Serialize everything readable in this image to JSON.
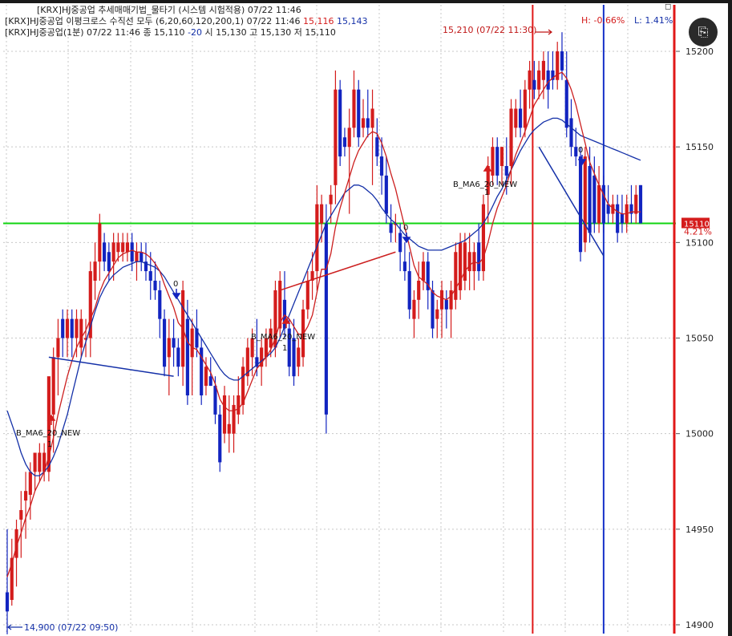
{
  "legend": {
    "line1": "[KRX]HJ중공업 추세매매기법_물타기 (시스템 시험적용) 07/22 11:46",
    "line2_prefix": "[KRX]HJ중공업 이평크로스 수직선 모두  (6,20,60,120,200,1) 07/22 11:46",
    "line2_val1": "15,116",
    "line2_val2": "15,143",
    "line3_prefix": "[KRX]HJ중공업(1분) 07/22 11:46   종 15,110",
    "line3_change": "-20",
    "line3_suffix": "  시 15,130 고 15,130 저 15,110"
  },
  "header_right": {
    "high_label": "H: -0.66%",
    "low_label": "L: 1.41%",
    "corner_glyph": "◻"
  },
  "ocr_button": {
    "label": "⎘"
  },
  "colors": {
    "up": "#d41c1c",
    "down": "#1224c0",
    "ma_short": "#cc1f1f",
    "ma_long": "#1430a8",
    "ref_line": "#11d411",
    "grid": "#c7c7c7",
    "axis_text": "#222222"
  },
  "chart_data": {
    "type": "candlestick",
    "y_axis": {
      "ticks": [
        15200,
        15150,
        15100,
        15050,
        15000,
        14950,
        14900
      ],
      "tick_labels": [
        "15200",
        "15150",
        "15100",
        "15050",
        "15000",
        "14950",
        "14900"
      ],
      "range": [
        14895,
        15215
      ],
      "current_price_label": "15110",
      "current_change_label": "4.21%"
    },
    "grid": true,
    "reference_line": 15110,
    "candles": [
      {
        "o": 14917,
        "h": 14950,
        "l": 14895,
        "c": 14907
      },
      {
        "o": 14913,
        "h": 14945,
        "l": 14910,
        "c": 14935
      },
      {
        "o": 14935,
        "h": 14955,
        "l": 14920,
        "c": 14950
      },
      {
        "o": 14955,
        "h": 14970,
        "l": 14935,
        "c": 14960
      },
      {
        "o": 14965,
        "h": 14980,
        "l": 14945,
        "c": 14970
      },
      {
        "o": 14968,
        "h": 14985,
        "l": 14955,
        "c": 14980
      },
      {
        "o": 14980,
        "h": 14985,
        "l": 14970,
        "c": 14990
      },
      {
        "o": 14980,
        "h": 14995,
        "l": 14975,
        "c": 14990
      },
      {
        "o": 14980,
        "h": 14995,
        "l": 14975,
        "c": 14990
      },
      {
        "o": 14980,
        "h": 15010,
        "l": 14975,
        "c": 15030
      },
      {
        "o": 15010,
        "h": 15045,
        "l": 14990,
        "c": 15040
      },
      {
        "o": 15040,
        "h": 15060,
        "l": 15020,
        "c": 15050
      },
      {
        "o": 15060,
        "h": 15065,
        "l": 15040,
        "c": 15050
      },
      {
        "o": 15050,
        "h": 15065,
        "l": 15040,
        "c": 15060
      },
      {
        "o": 15060,
        "h": 15065,
        "l": 15040,
        "c": 15050
      },
      {
        "o": 15050,
        "h": 15065,
        "l": 15040,
        "c": 15060
      },
      {
        "o": 15045,
        "h": 15065,
        "l": 15040,
        "c": 15060
      },
      {
        "o": 15050,
        "h": 15060,
        "l": 15040,
        "c": 15050
      },
      {
        "o": 15050,
        "h": 15090,
        "l": 15040,
        "c": 15085
      },
      {
        "o": 15080,
        "h": 15100,
        "l": 15070,
        "c": 15090
      },
      {
        "o": 15090,
        "h": 15115,
        "l": 15080,
        "c": 15110
      },
      {
        "o": 15100,
        "h": 15105,
        "l": 15085,
        "c": 15090
      },
      {
        "o": 15095,
        "h": 15100,
        "l": 15080,
        "c": 15085
      },
      {
        "o": 15090,
        "h": 15105,
        "l": 15080,
        "c": 15100
      },
      {
        "o": 15095,
        "h": 15105,
        "l": 15090,
        "c": 15100
      },
      {
        "o": 15095,
        "h": 15105,
        "l": 15090,
        "c": 15100
      },
      {
        "o": 15095,
        "h": 15105,
        "l": 15090,
        "c": 15100
      },
      {
        "o": 15100,
        "h": 15105,
        "l": 15085,
        "c": 15090
      },
      {
        "o": 15090,
        "h": 15100,
        "l": 15080,
        "c": 15095
      },
      {
        "o": 15095,
        "h": 15100,
        "l": 15085,
        "c": 15090
      },
      {
        "o": 15090,
        "h": 15100,
        "l": 15080,
        "c": 15085
      },
      {
        "o": 15085,
        "h": 15095,
        "l": 15070,
        "c": 15080
      },
      {
        "o": 15080,
        "h": 15090,
        "l": 15070,
        "c": 15075
      },
      {
        "o": 15075,
        "h": 15080,
        "l": 15050,
        "c": 15060
      },
      {
        "o": 15060,
        "h": 15065,
        "l": 15030,
        "c": 15035
      },
      {
        "o": 15040,
        "h": 15060,
        "l": 15020,
        "c": 15050
      },
      {
        "o": 15050,
        "h": 15060,
        "l": 15035,
        "c": 15045
      },
      {
        "o": 15045,
        "h": 15050,
        "l": 15030,
        "c": 15035
      },
      {
        "o": 15035,
        "h": 15080,
        "l": 15025,
        "c": 15075
      },
      {
        "o": 15060,
        "h": 15070,
        "l": 15015,
        "c": 15020
      },
      {
        "o": 15040,
        "h": 15060,
        "l": 15020,
        "c": 15055
      },
      {
        "o": 15055,
        "h": 15065,
        "l": 15040,
        "c": 15045
      },
      {
        "o": 15045,
        "h": 15050,
        "l": 15015,
        "c": 15020
      },
      {
        "o": 15025,
        "h": 15040,
        "l": 15020,
        "c": 15035
      },
      {
        "o": 15030,
        "h": 15040,
        "l": 15025,
        "c": 15025
      },
      {
        "o": 15025,
        "h": 15030,
        "l": 15005,
        "c": 15010
      },
      {
        "o": 15010,
        "h": 15015,
        "l": 14980,
        "c": 14985
      },
      {
        "o": 15000,
        "h": 15025,
        "l": 14995,
        "c": 15020
      },
      {
        "o": 15000,
        "h": 15020,
        "l": 14990,
        "c": 15005
      },
      {
        "o": 15000,
        "h": 15020,
        "l": 14990,
        "c": 15015
      },
      {
        "o": 15010,
        "h": 15030,
        "l": 15005,
        "c": 15020
      },
      {
        "o": 15015,
        "h": 15040,
        "l": 15010,
        "c": 15035
      },
      {
        "o": 15030,
        "h": 15050,
        "l": 15025,
        "c": 15045
      },
      {
        "o": 15040,
        "h": 15055,
        "l": 15030,
        "c": 15050
      },
      {
        "o": 15040,
        "h": 15060,
        "l": 15030,
        "c": 15035
      },
      {
        "o": 15035,
        "h": 15050,
        "l": 15025,
        "c": 15045
      },
      {
        "o": 15040,
        "h": 15055,
        "l": 15035,
        "c": 15050
      },
      {
        "o": 15045,
        "h": 15060,
        "l": 15040,
        "c": 15055
      },
      {
        "o": 15045,
        "h": 15080,
        "l": 15040,
        "c": 15075
      },
      {
        "o": 15055,
        "h": 15085,
        "l": 15050,
        "c": 15080
      },
      {
        "o": 15070,
        "h": 15085,
        "l": 15050,
        "c": 15055
      },
      {
        "o": 15055,
        "h": 15060,
        "l": 15030,
        "c": 15035
      },
      {
        "o": 15050,
        "h": 15060,
        "l": 15025,
        "c": 15030
      },
      {
        "o": 15035,
        "h": 15050,
        "l": 15030,
        "c": 15045
      },
      {
        "o": 15040,
        "h": 15070,
        "l": 15035,
        "c": 15065
      },
      {
        "o": 15065,
        "h": 15085,
        "l": 15060,
        "c": 15080
      },
      {
        "o": 15080,
        "h": 15095,
        "l": 15070,
        "c": 15085
      },
      {
        "o": 15085,
        "h": 15130,
        "l": 15075,
        "c": 15120
      },
      {
        "o": 15110,
        "h": 15125,
        "l": 15100,
        "c": 15120
      },
      {
        "o": 15110,
        "h": 15120,
        "l": 15000,
        "c": 15010
      },
      {
        "o": 15120,
        "h": 15130,
        "l": 15110,
        "c": 15125
      },
      {
        "o": 15130,
        "h": 15190,
        "l": 15120,
        "c": 15180
      },
      {
        "o": 15180,
        "h": 15185,
        "l": 15140,
        "c": 15145
      },
      {
        "o": 15155,
        "h": 15160,
        "l": 15145,
        "c": 15150
      },
      {
        "o": 15150,
        "h": 15170,
        "l": 15115,
        "c": 15160
      },
      {
        "o": 15160,
        "h": 15190,
        "l": 15155,
        "c": 15180
      },
      {
        "o": 15180,
        "h": 15185,
        "l": 15150,
        "c": 15155
      },
      {
        "o": 15160,
        "h": 15175,
        "l": 15155,
        "c": 15165
      },
      {
        "o": 15165,
        "h": 15180,
        "l": 15155,
        "c": 15160
      },
      {
        "o": 15160,
        "h": 15180,
        "l": 15130,
        "c": 15170
      },
      {
        "o": 15155,
        "h": 15165,
        "l": 15140,
        "c": 15145
      },
      {
        "o": 15145,
        "h": 15155,
        "l": 15125,
        "c": 15135
      },
      {
        "o": 15135,
        "h": 15145,
        "l": 15110,
        "c": 15115
      },
      {
        "o": 15110,
        "h": 15120,
        "l": 15100,
        "c": 15105
      },
      {
        "o": 15110,
        "h": 15115,
        "l": 15100,
        "c": 15110
      },
      {
        "o": 15105,
        "h": 15110,
        "l": 15085,
        "c": 15095
      },
      {
        "o": 15090,
        "h": 15100,
        "l": 15080,
        "c": 15085
      },
      {
        "o": 15085,
        "h": 15095,
        "l": 15060,
        "c": 15065
      },
      {
        "o": 15060,
        "h": 15075,
        "l": 15050,
        "c": 15070
      },
      {
        "o": 15070,
        "h": 15090,
        "l": 15060,
        "c": 15080
      },
      {
        "o": 15080,
        "h": 15095,
        "l": 15075,
        "c": 15090
      },
      {
        "o": 15090,
        "h": 15095,
        "l": 15065,
        "c": 15075
      },
      {
        "o": 15075,
        "h": 15080,
        "l": 15050,
        "c": 15055
      },
      {
        "o": 15060,
        "h": 15070,
        "l": 15050,
        "c": 15065
      },
      {
        "o": 15065,
        "h": 15080,
        "l": 15050,
        "c": 15075
      },
      {
        "o": 15070,
        "h": 15075,
        "l": 15055,
        "c": 15065
      },
      {
        "o": 15065,
        "h": 15080,
        "l": 15050,
        "c": 15075
      },
      {
        "o": 15070,
        "h": 15100,
        "l": 15065,
        "c": 15095
      },
      {
        "o": 15075,
        "h": 15105,
        "l": 15070,
        "c": 15100
      },
      {
        "o": 15080,
        "h": 15105,
        "l": 15075,
        "c": 15100
      },
      {
        "o": 15085,
        "h": 15105,
        "l": 15075,
        "c": 15095
      },
      {
        "o": 15085,
        "h": 15100,
        "l": 15075,
        "c": 15095
      },
      {
        "o": 15100,
        "h": 15110,
        "l": 15080,
        "c": 15085
      },
      {
        "o": 15085,
        "h": 15125,
        "l": 15080,
        "c": 15120
      },
      {
        "o": 15125,
        "h": 15145,
        "l": 15110,
        "c": 15140
      },
      {
        "o": 15135,
        "h": 15155,
        "l": 15130,
        "c": 15150
      },
      {
        "o": 15150,
        "h": 15155,
        "l": 15130,
        "c": 15135
      },
      {
        "o": 15140,
        "h": 15150,
        "l": 15130,
        "c": 15150
      },
      {
        "o": 15140,
        "h": 15155,
        "l": 15125,
        "c": 15135
      },
      {
        "o": 15140,
        "h": 15175,
        "l": 15130,
        "c": 15170
      },
      {
        "o": 15160,
        "h": 15175,
        "l": 15155,
        "c": 15170
      },
      {
        "o": 15170,
        "h": 15180,
        "l": 15155,
        "c": 15160
      },
      {
        "o": 15160,
        "h": 15185,
        "l": 15155,
        "c": 15180
      },
      {
        "o": 15180,
        "h": 15195,
        "l": 15170,
        "c": 15190
      },
      {
        "o": 15185,
        "h": 15195,
        "l": 15175,
        "c": 15180
      },
      {
        "o": 15180,
        "h": 15195,
        "l": 15175,
        "c": 15190
      },
      {
        "o": 15185,
        "h": 15200,
        "l": 15175,
        "c": 15195
      },
      {
        "o": 15190,
        "h": 15200,
        "l": 15170,
        "c": 15180
      },
      {
        "o": 15190,
        "h": 15200,
        "l": 15180,
        "c": 15185
      },
      {
        "o": 15185,
        "h": 15205,
        "l": 15180,
        "c": 15200
      },
      {
        "o": 15200,
        "h": 15210,
        "l": 15185,
        "c": 15190
      },
      {
        "o": 15185,
        "h": 15200,
        "l": 15155,
        "c": 15160
      },
      {
        "o": 15165,
        "h": 15175,
        "l": 15145,
        "c": 15150
      },
      {
        "o": 15150,
        "h": 15160,
        "l": 15140,
        "c": 15145
      },
      {
        "o": 15145,
        "h": 15150,
        "l": 15090,
        "c": 15095
      },
      {
        "o": 15100,
        "h": 15150,
        "l": 15095,
        "c": 15145
      },
      {
        "o": 15140,
        "h": 15150,
        "l": 15100,
        "c": 15105
      },
      {
        "o": 15135,
        "h": 15145,
        "l": 15105,
        "c": 15110
      },
      {
        "o": 15110,
        "h": 15140,
        "l": 15105,
        "c": 15130
      },
      {
        "o": 15130,
        "h": 15135,
        "l": 15105,
        "c": 15110
      },
      {
        "o": 15120,
        "h": 15130,
        "l": 15110,
        "c": 15115
      },
      {
        "o": 15115,
        "h": 15125,
        "l": 15110,
        "c": 15120
      },
      {
        "o": 15120,
        "h": 15125,
        "l": 15100,
        "c": 15105
      },
      {
        "o": 15115,
        "h": 15125,
        "l": 15105,
        "c": 15110
      },
      {
        "o": 15110,
        "h": 15125,
        "l": 15105,
        "c": 15120
      },
      {
        "o": 15120,
        "h": 15130,
        "l": 15110,
        "c": 15115
      },
      {
        "o": 15115,
        "h": 15130,
        "l": 15110,
        "c": 15125
      },
      {
        "o": 15130,
        "h": 15130,
        "l": 15110,
        "c": 15110
      }
    ],
    "ma_short": [
      14925,
      14932,
      14941,
      14948,
      14956,
      14962,
      14970,
      14975,
      14980,
      14988,
      14998,
      15010,
      15020,
      15030,
      15038,
      15045,
      15050,
      15054,
      15060,
      15066,
      15074,
      15080,
      15084,
      15088,
      15092,
      15094,
      15095,
      15096,
      15095,
      15095,
      15094,
      15092,
      15089,
      15085,
      15078,
      15072,
      15066,
      15058,
      15055,
      15048,
      15045,
      15044,
      15040,
      15036,
      15032,
      15026,
      15018,
      15014,
      15012,
      15012,
      15013,
      15016,
      15022,
      15028,
      15034,
      15037,
      15040,
      15044,
      15050,
      15058,
      15062,
      15060,
      15056,
      15052,
      15052,
      15056,
      15062,
      15074,
      15086,
      15086,
      15094,
      15108,
      15118,
      15126,
      15134,
      15142,
      15148,
      15152,
      15156,
      15158,
      15157,
      15152,
      15145,
      15136,
      15128,
      15118,
      15108,
      15098,
      15088,
      15082,
      15080,
      15078,
      15074,
      15072,
      15071,
      15070,
      15072,
      15076,
      15080,
      15085,
      15088,
      15090,
      15089,
      15092,
      15100,
      15110,
      15118,
      15124,
      15130,
      15138,
      15146,
      15152,
      15158,
      15165,
      15172,
      15176,
      15180,
      15184,
      15186,
      15188,
      15189,
      15186,
      15180,
      15172,
      15162,
      15152,
      15142,
      15136,
      15130,
      15125,
      15120,
      15118,
      15116,
      15115,
      15115,
      15116,
      15116,
      15116
    ],
    "ma_long": [
      15012,
      15005,
      14998,
      14990,
      14984,
      14980,
      14978,
      14978,
      14980,
      14983,
      14988,
      14994,
      15002,
      15010,
      15020,
      15030,
      15040,
      15048,
      15056,
      15064,
      15071,
      15076,
      15080,
      15083,
      15085,
      15087,
      15088,
      15089,
      15090,
      15090,
      15089,
      15088,
      15087,
      15085,
      15082,
      15078,
      15074,
      15070,
      15066,
      15062,
      15058,
      15054,
      15050,
      15046,
      15042,
      15038,
      15034,
      15031,
      15029,
      15028,
      15028,
      15030,
      15032,
      15034,
      15036,
      15038,
      15040,
      15042,
      15045,
      15050,
      15056,
      15062,
      15068,
      15074,
      15080,
      15086,
      15092,
      15098,
      15104,
      15110,
      15114,
      15118,
      15122,
      15126,
      15128,
      15130,
      15130,
      15129,
      15127,
      15125,
      15122,
      15118,
      15115,
      15112,
      15110,
      15107,
      15104,
      15102,
      15100,
      15098,
      15097,
      15096,
      15096,
      15096,
      15096,
      15097,
      15098,
      15099,
      15100,
      15101,
      15103,
      15105,
      15107,
      15110,
      15114,
      15119,
      15124,
      15128,
      15133,
      15138,
      15143,
      15148,
      15152,
      15156,
      15159,
      15161,
      15163,
      15164,
      15165,
      15165,
      15164,
      15162,
      15160,
      15158,
      15156,
      15155,
      15154,
      15153,
      15152,
      15151,
      15150,
      15149,
      15148,
      15147,
      15146,
      15145,
      15144,
      15143
    ]
  },
  "annotations": {
    "signal_label": "B_MA6_20_NEW",
    "signal_count": "1",
    "exit_marker": "0",
    "high_annotation": "15,210 (07/22 11:30)",
    "low_annotation": "14,900 (07/22 09:50)"
  }
}
